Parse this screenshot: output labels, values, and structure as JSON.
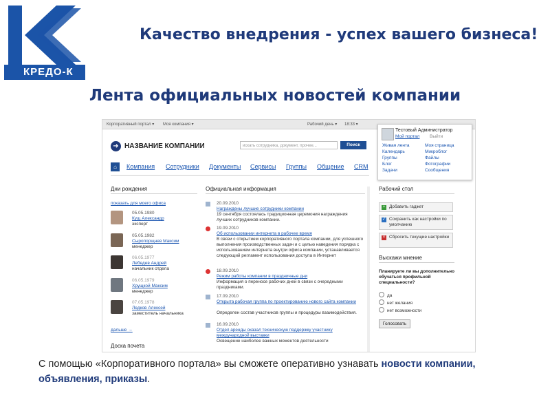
{
  "logo": {
    "text": "КРЕДО-К"
  },
  "tagline": "Качество внедрения - успех вашего бизнеса!",
  "headline": "Лента официальных новостей компании",
  "portal": {
    "topbar": {
      "left1": "Корпоративный портал ▾",
      "left2": "Моя компания ▾",
      "right1": "Рабочий день ▾",
      "right2": "18:33 ▾"
    },
    "user": {
      "name": "Тестовый Администратор",
      "my_portal": "Мой портал",
      "exit": "Выйти",
      "col1": [
        "Живая лента",
        "Календарь",
        "Группы",
        "Блог",
        "Задачи"
      ],
      "col2": [
        "Моя страница",
        "Микроблог",
        "Файлы",
        "Фотографии",
        "Сообщения"
      ]
    },
    "brand": "НАЗВАНИЕ КОМПАНИИ",
    "search_placeholder": "искать сотрудника, документ, прочее...",
    "search_button": "Поиск",
    "nav": [
      "Компания",
      "Сотрудники",
      "Документы",
      "Сервисы",
      "Группы",
      "Общение",
      "CRM"
    ],
    "birthdays": {
      "heading": "Дни рождения",
      "link": "показать для моего офиса",
      "people": [
        {
          "date": "05.05.1980",
          "name": "Кущ Александр",
          "role": "эксперт"
        },
        {
          "date": "05.05.1982",
          "name": "Сыропорщнев Максим",
          "role": "менеджер"
        },
        {
          "date": "06.05.1977",
          "name": "Лебедев Андрей",
          "role": "начальник отдела"
        },
        {
          "date": "06.05.1979",
          "name": "Хрущкой Максим",
          "role": "менеджер"
        },
        {
          "date": "07.05.1978",
          "name": "Ледков Алексей",
          "role": "заместитель начальника"
        }
      ],
      "more": "дальше →"
    },
    "honor_board": "Доска почета",
    "official": {
      "heading": "Официальная информация",
      "items": [
        {
          "date": "20.09.2010",
          "title": "Награждены лучшие сотрудники компании",
          "text": "19 сентября состоялась традиционная церемония награждения лучших сотрудников компании."
        },
        {
          "date": "19.09.2010",
          "title": "Об использовании интернета в рабочее время",
          "text": "В связи с открытием корпоративного портала компании, для успешного выполнения производственных задач и с целью наведения порядка с использованием интернета внутри офиса компании, устанавливается следующий регламент использования доступа в Интернет"
        },
        {
          "date": "18.09.2010",
          "title": "Режим работы компании в праздничные дни",
          "text": "Информация о переносе рабочих дней в связи с очередными праздниками."
        },
        {
          "date": "17.09.2010",
          "title": "Открыта рабочая группа по проектированию нового сайта компании",
          "text": "Определен состав участников группы и процедуры взаимодействия."
        },
        {
          "date": "16.09.2010",
          "title": "Отдел аренды оказал техническую поддержку участнику международной выставки",
          "text": "Освещение наиболее важных моментов деятельности"
        }
      ]
    },
    "desktop": {
      "heading": "Рабочий стол",
      "buttons": [
        "Добавить гаджет",
        "Сохранить как настройки по умолчанию",
        "Сбросить текущие настройки"
      ]
    },
    "poll": {
      "heading": "Выскажи мнение",
      "question": "Планируете ли вы дополнительно обучаться профильной специальности?",
      "options": [
        "да",
        "нет желания",
        "нет возможности"
      ],
      "vote": "Голосовать"
    }
  },
  "caption": {
    "part1": "С помощью «Корпоративного портала» вы сможете оперативно узнавать ",
    "bold1": "новости компании, объявления, приказы",
    "end": "."
  }
}
